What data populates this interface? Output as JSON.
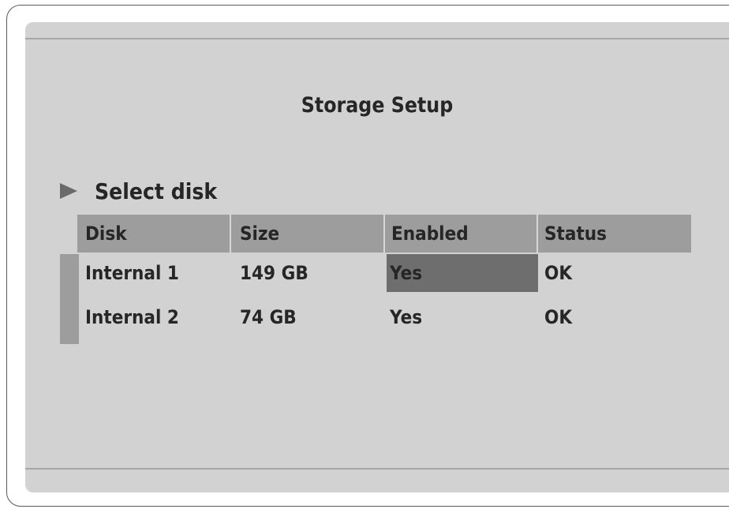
{
  "screen": {
    "title": "Storage Setup"
  },
  "section": {
    "label": "Select disk"
  },
  "table": {
    "headers": {
      "disk": "Disk",
      "size": "Size",
      "enabled": "Enabled",
      "status": "Status"
    },
    "rows": [
      {
        "disk": "Internal 1",
        "size": "149 GB",
        "enabled": "Yes",
        "status": "OK",
        "selected_column": "enabled"
      },
      {
        "disk": "Internal 2",
        "size": "74 GB",
        "enabled": "Yes",
        "status": "OK"
      }
    ]
  },
  "icons": {
    "pointer": "play-arrow-icon"
  },
  "colors": {
    "screen_background": "#d2d2d2",
    "header_background": "#9d9d9d",
    "selected_cell": "#6e6e6e",
    "text": "#262626"
  }
}
